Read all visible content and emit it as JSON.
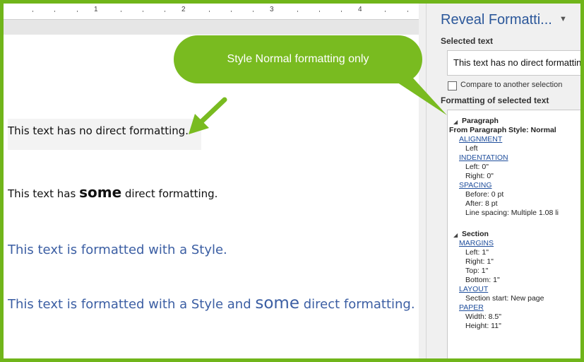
{
  "document": {
    "ruler_numbers": [
      "1",
      "2",
      "3",
      "4"
    ],
    "line1": "This text has no direct formatting.",
    "line2_prefix": "This text has ",
    "line2_emphasis": "some",
    "line2_suffix": " direct formatting.",
    "line3": "This text is formatted with a Style.",
    "line4_prefix": "This text is formatted with a Style and ",
    "line4_emphasis": "some",
    "line4_suffix": " direct formatting."
  },
  "callout": {
    "text": "Style Normal formatting only",
    "color": "#79bb20"
  },
  "pane": {
    "title": "Reveal Formatti...",
    "dropdown_icon": "triangle-down-icon",
    "selected_text_label": "Selected text",
    "selected_text_value": "This text has no direct formatting.",
    "compare_label": "Compare to another selection",
    "formatting_label": "Formatting of selected text",
    "paragraph": {
      "header": "Paragraph",
      "style_line": "From Paragraph Style: Normal",
      "alignment_link": "ALIGNMENT",
      "alignment_value": "Left",
      "indentation_link": "INDENTATION",
      "indent_left": "Left:  0\"",
      "indent_right": "Right:  0\"",
      "spacing_link": "SPACING",
      "spacing_before": "Before:  0 pt",
      "spacing_after": "After:  8 pt",
      "line_spacing": "Line spacing:  Multiple 1.08 li"
    },
    "section": {
      "header": "Section",
      "margins_link": "MARGINS",
      "margin_left": "Left:  1\"",
      "margin_right": "Right:  1\"",
      "margin_top": "Top:  1\"",
      "margin_bottom": "Bottom:  1\"",
      "layout_link": "LAYOUT",
      "section_start": "Section start: New page",
      "paper_link": "PAPER",
      "paper_width": "Width:  8.5\"",
      "paper_height": "Height:  11\""
    }
  },
  "colors": {
    "frame": "#70b51a",
    "style_text": "#3b5ea3",
    "pane_title": "#2b579a",
    "link": "#1f4e9c"
  }
}
